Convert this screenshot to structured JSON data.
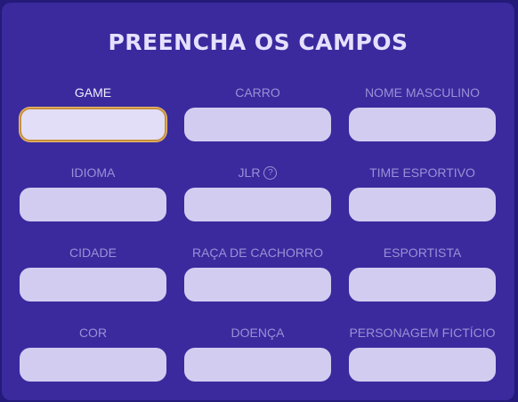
{
  "title": "PREENCHA OS CAMPOS",
  "help_glyph": "?",
  "fields": [
    {
      "label": "GAME",
      "value": "",
      "active": true
    },
    {
      "label": "CARRO",
      "value": ""
    },
    {
      "label": "NOME MASCULINO",
      "value": ""
    },
    {
      "label": "IDIOMA",
      "value": ""
    },
    {
      "label": "JLR",
      "value": "",
      "help_icon": "question-circle-icon"
    },
    {
      "label": "TIME ESPORTIVO",
      "value": ""
    },
    {
      "label": "CIDADE",
      "value": ""
    },
    {
      "label": "RAÇA DE CACHORRO",
      "value": ""
    },
    {
      "label": "ESPORTISTA",
      "value": ""
    },
    {
      "label": "COR",
      "value": ""
    },
    {
      "label": "DOENÇA",
      "value": ""
    },
    {
      "label": "PERSONAGEM FICTÍCIO",
      "value": ""
    }
  ],
  "colors": {
    "background": "#241a7a",
    "panel": "#3a2a9e",
    "title": "#e6e0ff",
    "label": "#9a90d6",
    "label_active": "#f1edff",
    "input": "#d2cdf0",
    "input_active_border": "#c7903c"
  }
}
